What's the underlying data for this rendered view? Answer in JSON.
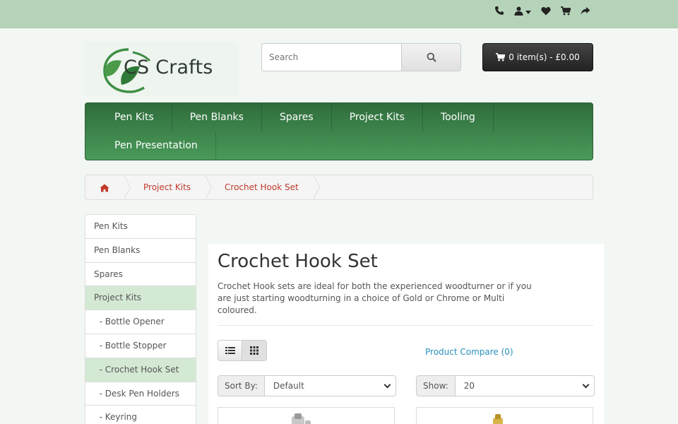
{
  "topbar": {
    "icons": [
      "phone-icon",
      "user-icon",
      "heart-icon",
      "cart-icon",
      "share-icon"
    ]
  },
  "logo": {
    "text": "CS Crafts"
  },
  "search": {
    "placeholder": "Search"
  },
  "cart": {
    "label": "0 item(s) - £0.00"
  },
  "nav": {
    "row1": [
      "Pen Kits",
      "Pen Blanks",
      "Spares",
      "Project Kits",
      "Tooling"
    ],
    "row2": [
      "Pen Presentation"
    ]
  },
  "breadcrumb": {
    "items": [
      "Project Kits",
      "Crochet Hook Set"
    ]
  },
  "sidebar": {
    "items": [
      {
        "label": "Pen Kits"
      },
      {
        "label": "Pen Blanks"
      },
      {
        "label": "Spares"
      },
      {
        "label": "Project Kits"
      },
      {
        "label": "  - Bottle Opener"
      },
      {
        "label": "  - Bottle Stopper"
      },
      {
        "label": "  - Crochet Hook Set"
      },
      {
        "label": "  - Desk Pen Holders"
      },
      {
        "label": "  - Keyring"
      }
    ]
  },
  "main": {
    "title": "Crochet Hook Set",
    "description": "Crochet Hook sets are ideal for both the experienced woodturner or if you are just starting woodturning in a choice of Gold or Chrome or Multi coloured.",
    "compare": "Product Compare (0)",
    "sort_label": "Sort By:",
    "sort_value": "Default",
    "show_label": "Show:",
    "show_value": "20"
  }
}
